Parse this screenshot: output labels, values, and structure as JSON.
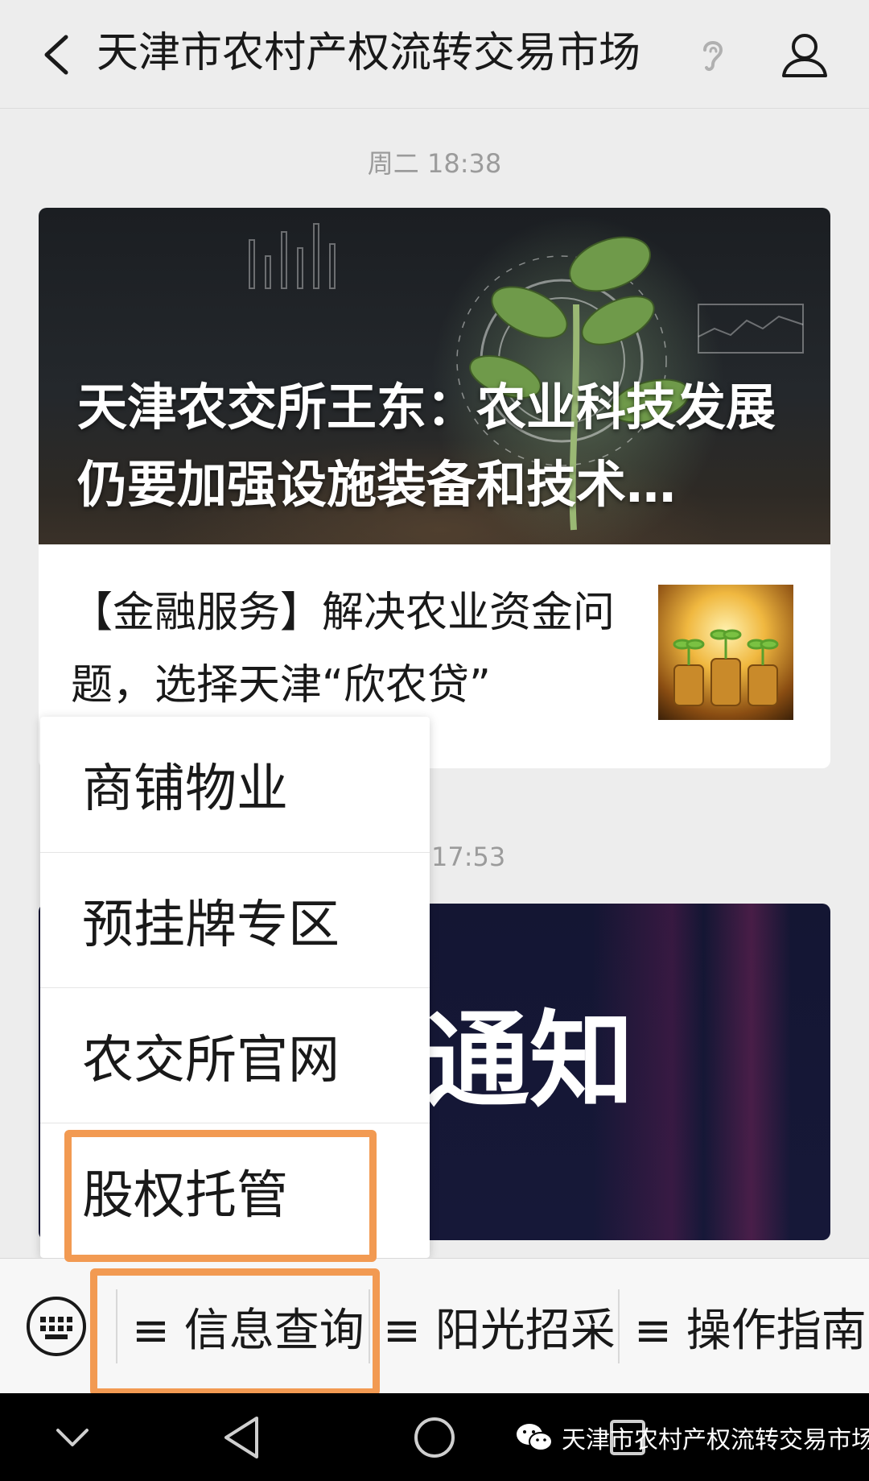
{
  "header": {
    "title": "天津市农村产权流转交易市场"
  },
  "messages": [
    {
      "timestamp": "周二 18:38",
      "cover_title": "天津农交所王东：农业科技发展仍要加强设施装备和技术…",
      "sub_title": "【金融服务】解决农业资金问题，选择天津“欣农贷”"
    },
    {
      "timestamp_partial": "17:53",
      "cover_text": "通知"
    }
  ],
  "popup_menu": {
    "items": [
      "商铺物业",
      "预挂牌专区",
      "农交所官网",
      "股权托管"
    ]
  },
  "menu_bar": {
    "items": [
      "≡ 信息查询",
      "≡ 阳光招采",
      "≡ 操作指南"
    ]
  },
  "watermark": {
    "text": "天津市农村产权流转交易市场"
  },
  "colors": {
    "highlight": "#f29a52",
    "background": "#ededed"
  }
}
